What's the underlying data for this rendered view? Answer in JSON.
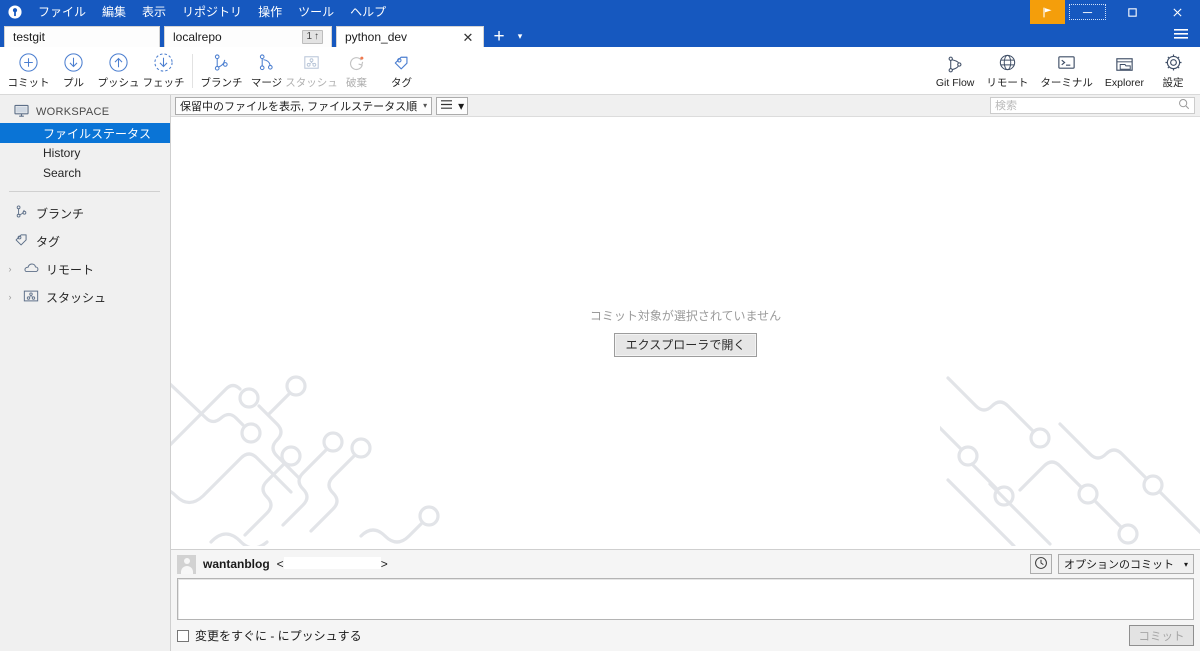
{
  "window": {
    "menus": [
      "ファイル",
      "編集",
      "表示",
      "リポジトリ",
      "操作",
      "ツール",
      "ヘルプ"
    ],
    "controls": {
      "flag": "flag-icon",
      "minimize": "–",
      "maximize": "□",
      "close": "✕",
      "hamburger": "≡"
    },
    "accent_color": "#1658bf",
    "flag_color": "#f49e0b"
  },
  "tabs": {
    "items": [
      {
        "label": "testgit",
        "badge": "",
        "active": false,
        "closable": false
      },
      {
        "label": "localrepo",
        "badge": "1",
        "badge_icon": "↑",
        "active": false,
        "closable": false
      },
      {
        "label": "python_dev",
        "badge": "",
        "active": true,
        "closable": true
      }
    ],
    "new_tab_label": "+",
    "tab_list_label": "▾"
  },
  "toolbar": {
    "left": [
      {
        "label": "コミット",
        "icon": "plus-circle-icon",
        "disabled": false
      },
      {
        "label": "プル",
        "icon": "arrow-down-circle-icon",
        "disabled": false
      },
      {
        "label": "プッシュ",
        "icon": "arrow-up-circle-icon",
        "disabled": false
      },
      {
        "label": "フェッチ",
        "icon": "arrow-down-dashed-circle-icon",
        "disabled": false
      },
      {
        "label": "ブランチ",
        "icon": "branch-icon",
        "disabled": false
      },
      {
        "label": "マージ",
        "icon": "merge-icon",
        "disabled": false
      },
      {
        "label": "スタッシュ",
        "icon": "stash-icon",
        "disabled": true
      },
      {
        "label": "破棄",
        "icon": "discard-refresh-icon",
        "disabled": true
      },
      {
        "label": "タグ",
        "icon": "tag-icon",
        "disabled": false
      }
    ],
    "right": [
      {
        "label": "Git Flow",
        "icon": "gitflow-icon"
      },
      {
        "label": "リモート",
        "icon": "globe-icon"
      },
      {
        "label": "ターミナル",
        "icon": "terminal-icon"
      },
      {
        "label": "Explorer",
        "icon": "folder-window-icon"
      },
      {
        "label": "設定",
        "icon": "gear-icon"
      }
    ]
  },
  "sidebar": {
    "workspace": {
      "label": "WORKSPACE",
      "icon": "monitor-icon"
    },
    "workspace_items": [
      {
        "label": "ファイルステータス",
        "selected": true
      },
      {
        "label": "History",
        "selected": false
      },
      {
        "label": "Search",
        "selected": false
      }
    ],
    "sections": [
      {
        "label": "ブランチ",
        "icon": "branch-icon",
        "caret": ""
      },
      {
        "label": "タグ",
        "icon": "tag-icon",
        "caret": ""
      },
      {
        "label": "リモート",
        "icon": "cloud-icon",
        "caret": "›"
      },
      {
        "label": "スタッシュ",
        "icon": "stash-icon",
        "caret": "›"
      }
    ]
  },
  "filterbar": {
    "view_filter": "保留中のファイルを表示, ファイルステータス順",
    "view_filter_caret": "▾",
    "layout_icon": "list-lines-icon",
    "layout_caret": "▾",
    "search_placeholder": "検索",
    "search_value": "",
    "search_icon": "search-icon"
  },
  "main": {
    "empty_message": "コミット対象が選択されていません",
    "open_explorer_button": "エクスプローラで開く"
  },
  "commit_panel": {
    "author_name": "wantanblog",
    "email_prefix": "<",
    "email_value": "",
    "email_suffix": ">",
    "avatar_icon": "user-avatar-icon",
    "history_button_icon": "clock-icon",
    "options_button": "オプションのコミット",
    "options_caret": "▾",
    "message_value": "",
    "message_placeholder": "",
    "push_checkbox_label": "変更をすぐに - にプッシュする",
    "push_checkbox_checked": false,
    "commit_button": "コミット",
    "commit_button_disabled": true
  }
}
